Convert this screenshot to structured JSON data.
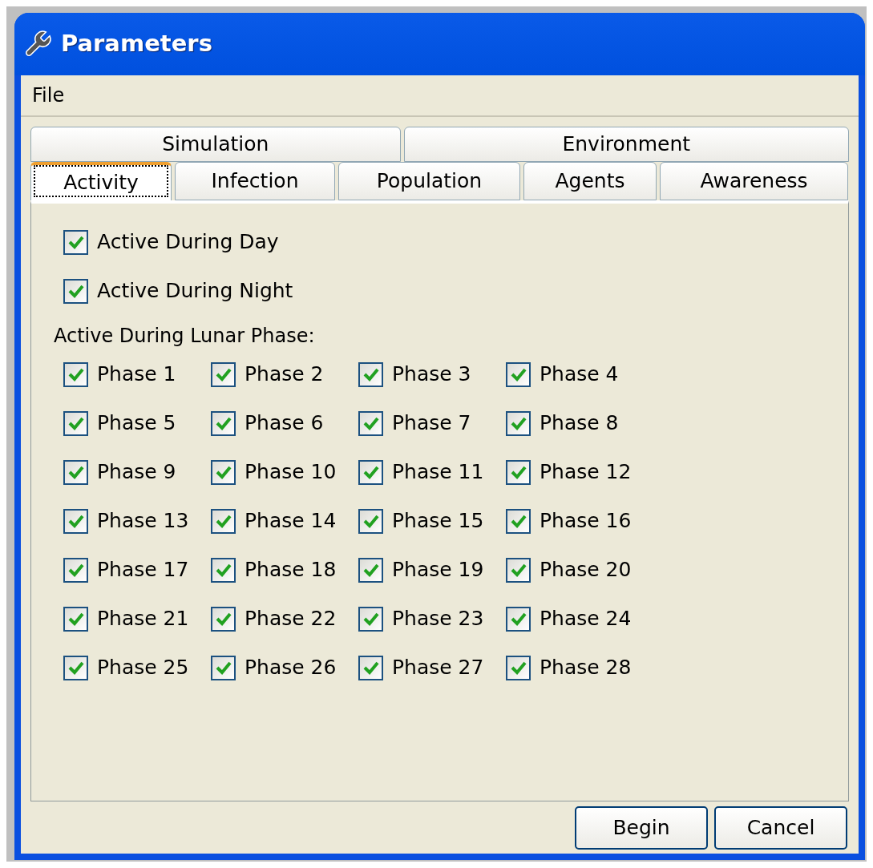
{
  "window": {
    "title": "Parameters"
  },
  "menu": [
    "File"
  ],
  "tab_rows": [
    [
      {
        "label": "Simulation",
        "selected": false
      },
      {
        "label": "Environment",
        "selected": false
      }
    ],
    [
      {
        "label": "Activity",
        "selected": true
      },
      {
        "label": "Infection",
        "selected": false
      },
      {
        "label": "Population",
        "selected": false
      },
      {
        "label": "Agents",
        "selected": false
      },
      {
        "label": "Awareness",
        "selected": false
      }
    ]
  ],
  "options": [
    {
      "label": "Active During Day",
      "checked": true
    },
    {
      "label": "Active During Night",
      "checked": true
    }
  ],
  "lunar_heading": "Active During Lunar Phase:",
  "phases": [
    {
      "label": "Phase 1",
      "checked": true
    },
    {
      "label": "Phase 2",
      "checked": true
    },
    {
      "label": "Phase 3",
      "checked": true
    },
    {
      "label": "Phase 4",
      "checked": true
    },
    {
      "label": "Phase 5",
      "checked": true
    },
    {
      "label": "Phase 6",
      "checked": true
    },
    {
      "label": "Phase 7",
      "checked": true
    },
    {
      "label": "Phase 8",
      "checked": true
    },
    {
      "label": "Phase 9",
      "checked": true
    },
    {
      "label": "Phase 10",
      "checked": true
    },
    {
      "label": "Phase 11",
      "checked": true
    },
    {
      "label": "Phase 12",
      "checked": true
    },
    {
      "label": "Phase 13",
      "checked": true
    },
    {
      "label": "Phase 14",
      "checked": true
    },
    {
      "label": "Phase 15",
      "checked": true
    },
    {
      "label": "Phase 16",
      "checked": true
    },
    {
      "label": "Phase 17",
      "checked": true
    },
    {
      "label": "Phase 18",
      "checked": true
    },
    {
      "label": "Phase 19",
      "checked": true
    },
    {
      "label": "Phase 20",
      "checked": true
    },
    {
      "label": "Phase 21",
      "checked": true
    },
    {
      "label": "Phase 22",
      "checked": true
    },
    {
      "label": "Phase 23",
      "checked": true
    },
    {
      "label": "Phase 24",
      "checked": true
    },
    {
      "label": "Phase 25",
      "checked": true
    },
    {
      "label": "Phase 26",
      "checked": true
    },
    {
      "label": "Phase 27",
      "checked": true
    },
    {
      "label": "Phase 28",
      "checked": true
    }
  ],
  "buttons": [
    "Begin",
    "Cancel"
  ]
}
